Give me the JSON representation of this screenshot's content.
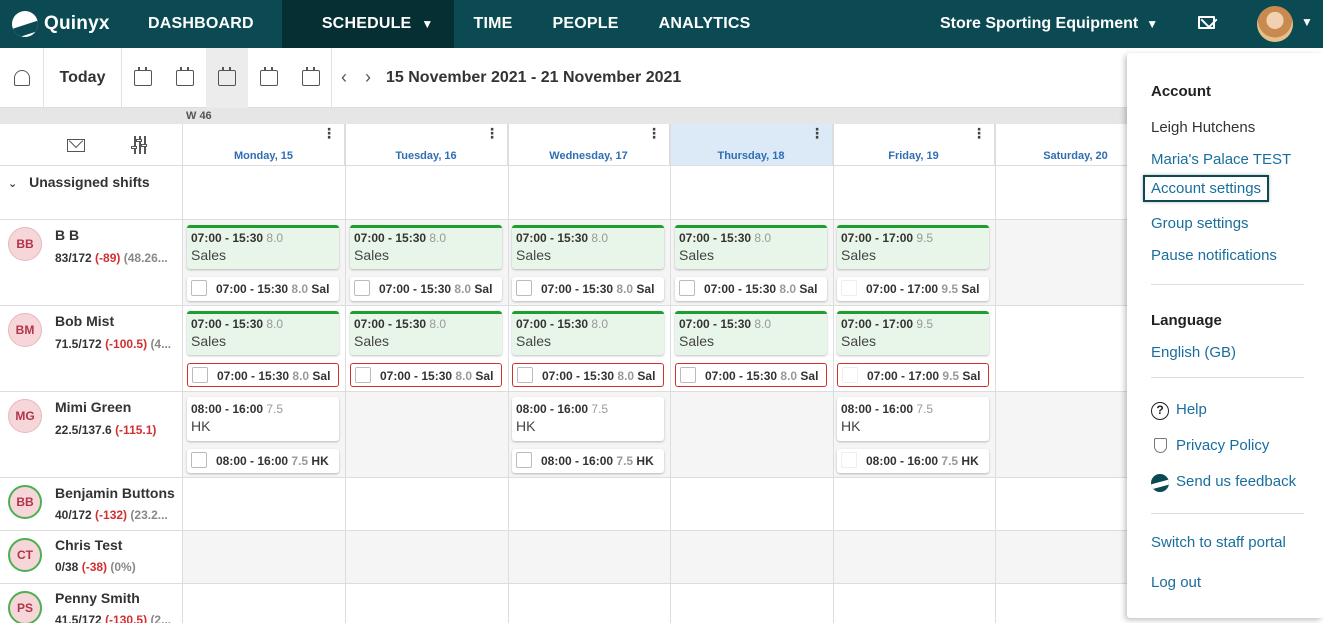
{
  "nav": {
    "brand": "Quinyx",
    "items": [
      "DASHBOARD",
      "SCHEDULE",
      "TIME",
      "PEOPLE",
      "ANALYTICS"
    ],
    "store": "Store Sporting Equipment"
  },
  "toolbar": {
    "today_label": "Today",
    "date_range": "15 November 2021 - 21 November 2021"
  },
  "grid": {
    "week_label": "W 46",
    "days": [
      "Monday, 15",
      "Tuesday, 16",
      "Wednesday, 17",
      "Thursday, 18",
      "Friday, 19",
      "Saturday, 20"
    ],
    "unassigned_label": "Unassigned shifts"
  },
  "employees": [
    {
      "initials": "BB",
      "name": "B B",
      "hours": "83/172",
      "diff": "(-89)",
      "pct": "(48.26..."
    },
    {
      "initials": "BM",
      "name": "Bob Mist",
      "hours": "71.5/172",
      "diff": "(-100.5)",
      "pct": "(4..."
    },
    {
      "initials": "MG",
      "name": "Mimi Green",
      "hours": "22.5/137.6",
      "diff": "(-115.1)",
      "pct": ""
    },
    {
      "initials": "BB",
      "name": "Benjamin Buttons",
      "hours": "40/172",
      "diff": "(-132)",
      "pct": "(23.2..."
    },
    {
      "initials": "CT",
      "name": "Chris Test",
      "hours": "0/38",
      "diff": "(-38)",
      "pct": "(0%)"
    },
    {
      "initials": "PS",
      "name": "Penny Smith",
      "hours": "41.5/172",
      "diff": "(-130.5)",
      "pct": "(2..."
    }
  ],
  "shifts": {
    "sales_std": {
      "time": "07:00 - 15:30",
      "hours": "8.0",
      "name": "Sales",
      "mini_tag": "Sal"
    },
    "sales_fri": {
      "time": "07:00 - 17:00",
      "hours": "9.5",
      "name": "Sales",
      "mini_tag": "Sal"
    },
    "hk": {
      "time": "08:00 - 16:00",
      "hours": "7.5",
      "name": "HK",
      "mini_tag": "HK"
    }
  },
  "menu": {
    "account_heading": "Account",
    "user_name": "Leigh Hutchens",
    "org": "Maria's Palace TEST",
    "account_settings": "Account settings",
    "group_settings": "Group settings",
    "pause_notifications": "Pause notifications",
    "language_heading": "Language",
    "language": "English (GB)",
    "help": "Help",
    "privacy": "Privacy Policy",
    "feedback": "Send us feedback",
    "switch_portal": "Switch to staff portal",
    "logout": "Log out"
  }
}
